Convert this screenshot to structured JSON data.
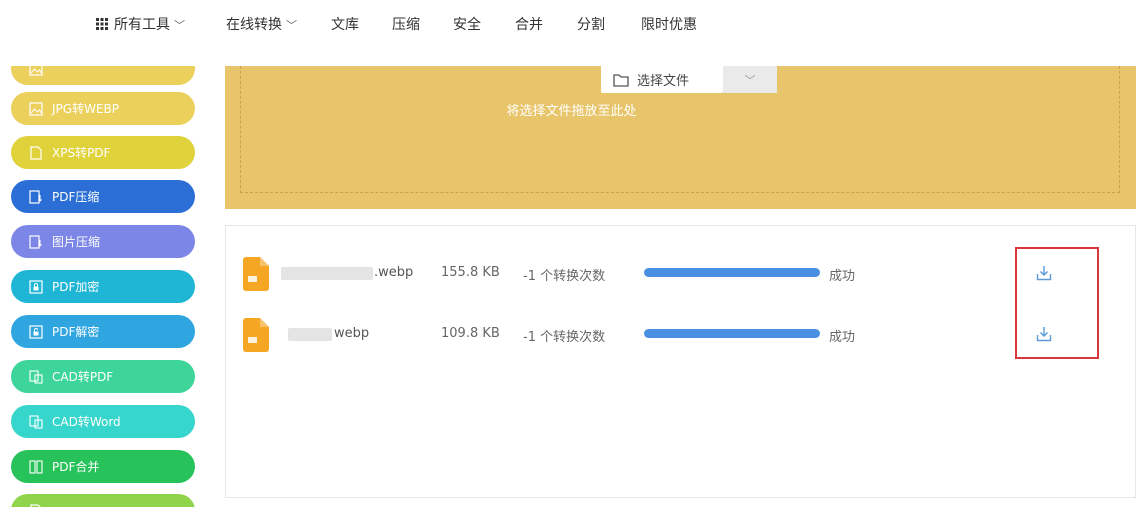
{
  "nav": {
    "items": [
      {
        "label": "所有工具",
        "has_dropdown": true
      },
      {
        "label": "在线转换",
        "has_dropdown": true
      },
      {
        "label": "文库",
        "has_dropdown": false
      },
      {
        "label": "压缩",
        "has_dropdown": false
      },
      {
        "label": "安全",
        "has_dropdown": false
      },
      {
        "label": "合并",
        "has_dropdown": false
      },
      {
        "label": "分割",
        "has_dropdown": false
      },
      {
        "label": "限时优惠",
        "has_dropdown": false
      }
    ]
  },
  "sidebar": {
    "items": [
      {
        "label": "",
        "color": "#ecd05c",
        "icon": "image-icon",
        "partial": "top"
      },
      {
        "label": "JPG转WEBP",
        "color": "#ecd05c",
        "icon": "image-icon"
      },
      {
        "label": "XPS转PDF",
        "color": "#e0d23a",
        "icon": "document-icon"
      },
      {
        "label": "PDF压缩",
        "color": "#2b6fd6",
        "icon": "compress-icon"
      },
      {
        "label": "图片压缩",
        "color": "#7b86e6",
        "icon": "compress-icon"
      },
      {
        "label": "PDF加密",
        "color": "#1fb6d6",
        "icon": "lock-icon"
      },
      {
        "label": "PDF解密",
        "color": "#2fa6e0",
        "icon": "unlock-icon"
      },
      {
        "label": "CAD转PDF",
        "color": "#3dd59a",
        "icon": "cad-icon"
      },
      {
        "label": "CAD转Word",
        "color": "#37d6cc",
        "icon": "cad-icon"
      },
      {
        "label": "PDF合并",
        "color": "#27c25a",
        "icon": "merge-icon"
      },
      {
        "label": "",
        "color": "#8fd44a",
        "icon": "document-icon",
        "partial": "bottom"
      }
    ]
  },
  "upload": {
    "select_label": "选择文件",
    "drop_hint": "将选择文件拖放至此处",
    "bg_color": "#e8c56a"
  },
  "files": [
    {
      "ext": ".webp",
      "size": "155.8 KB",
      "count": "-1 个转换次数",
      "progress": 1.0,
      "status": "成功"
    },
    {
      "ext": "webp",
      "size": "109.8 KB",
      "count": "-1 个转换次数",
      "progress": 1.0,
      "status": "成功"
    }
  ],
  "colors": {
    "progress": "#4a90e2",
    "highlight": "#d9363e",
    "file_icon": "#f5a623",
    "download": "#5a9bd8"
  }
}
